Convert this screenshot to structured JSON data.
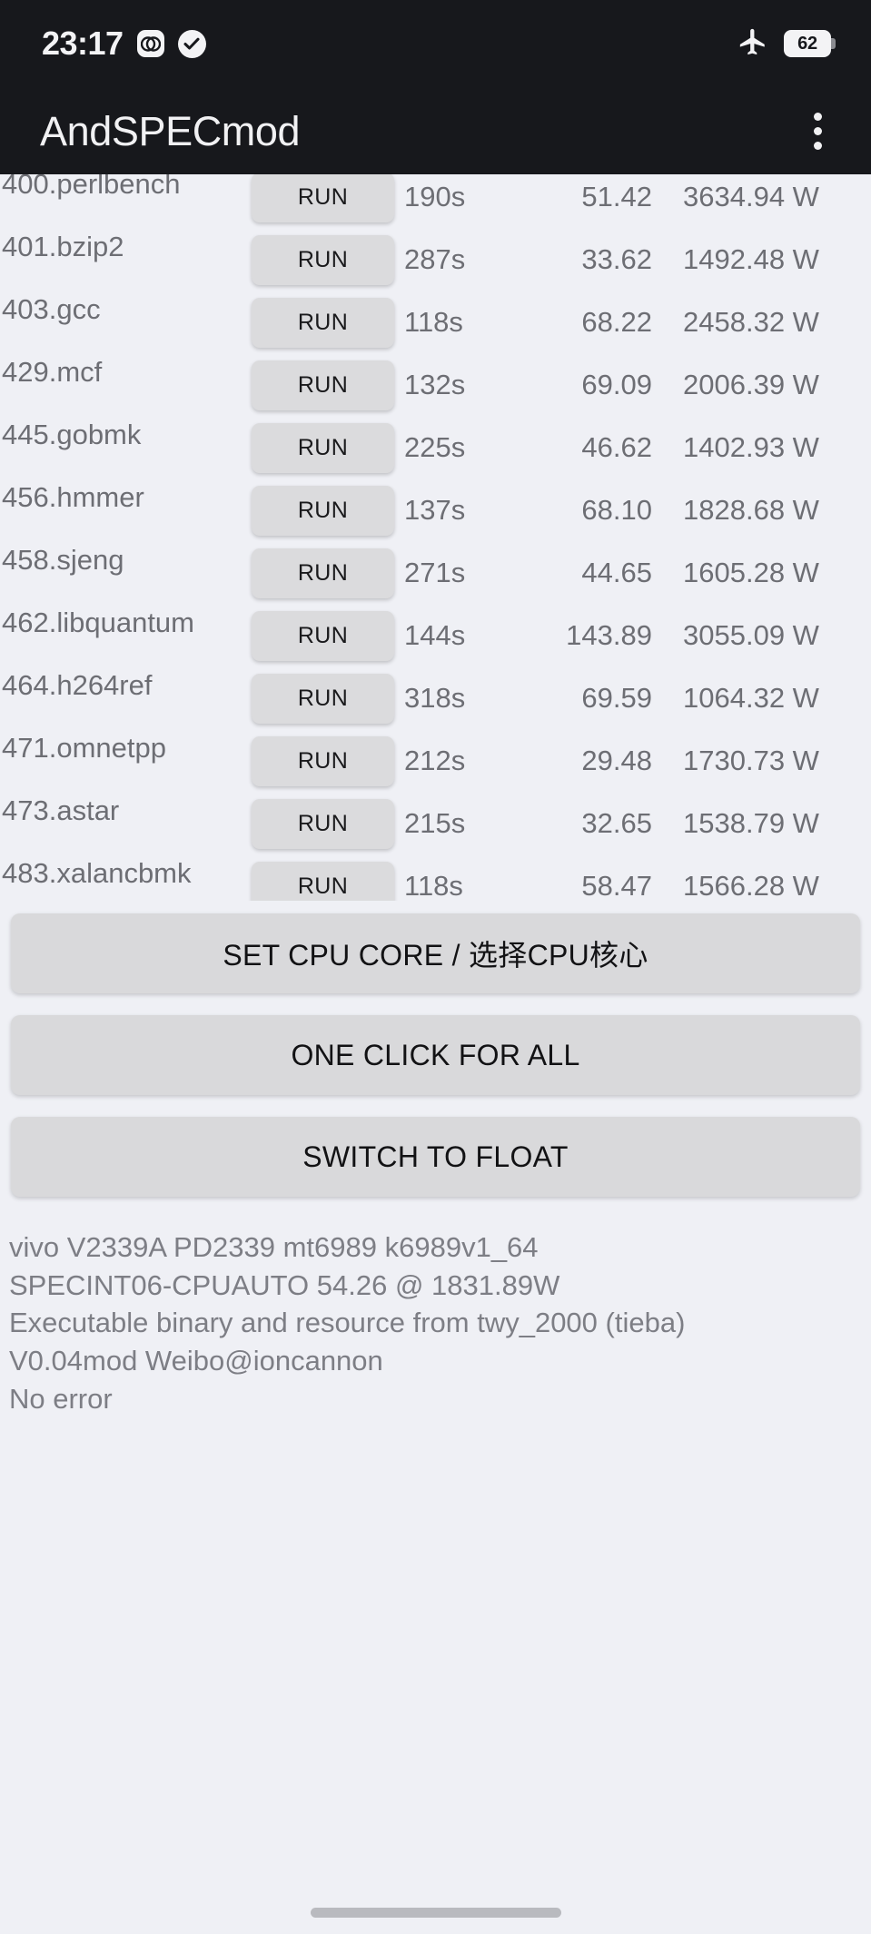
{
  "status_bar": {
    "clock": "23:17",
    "icons": [
      "dual-sim-icon",
      "check-circle-icon"
    ],
    "airplane_icon": "airplane-icon",
    "battery_level": "62"
  },
  "app_bar": {
    "title": "AndSPECmod",
    "overflow_icon": "overflow-menu-icon"
  },
  "table": {
    "run_label": "RUN",
    "rows": [
      {
        "name": "400.perlbench",
        "time": "190s",
        "score": "51.42",
        "power": "3634.94 W"
      },
      {
        "name": "401.bzip2",
        "time": "287s",
        "score": "33.62",
        "power": "1492.48 W"
      },
      {
        "name": "403.gcc",
        "time": "118s",
        "score": "68.22",
        "power": "2458.32 W"
      },
      {
        "name": "429.mcf",
        "time": "132s",
        "score": "69.09",
        "power": "2006.39 W"
      },
      {
        "name": "445.gobmk",
        "time": "225s",
        "score": "46.62",
        "power": "1402.93 W"
      },
      {
        "name": "456.hmmer",
        "time": "137s",
        "score": "68.10",
        "power": "1828.68 W"
      },
      {
        "name": "458.sjeng",
        "time": "271s",
        "score": "44.65",
        "power": "1605.28 W"
      },
      {
        "name": "462.libquantum",
        "time": "144s",
        "score": "143.89",
        "power": "3055.09 W"
      },
      {
        "name": "464.h264ref",
        "time": "318s",
        "score": "69.59",
        "power": "1064.32 W"
      },
      {
        "name": "471.omnetpp",
        "time": "212s",
        "score": "29.48",
        "power": "1730.73 W"
      },
      {
        "name": "473.astar",
        "time": "215s",
        "score": "32.65",
        "power": "1538.79 W"
      },
      {
        "name": "483.xalancbmk",
        "time": "118s",
        "score": "58.47",
        "power": "1566.28 W"
      }
    ]
  },
  "actions": {
    "set_cpu_core": "SET CPU CORE / 选择CPU核心",
    "one_click_for_all": "ONE CLICK FOR ALL",
    "switch_to_float": "SWITCH TO FLOAT"
  },
  "footer": {
    "lines": [
      "vivo V2339A PD2339 mt6989 k6989v1_64",
      "SPECINT06-CPUAUTO  54.26 @ 1831.89W",
      "Executable binary and resource from twy_2000 (tieba)",
      "V0.04mod  Weibo@ioncannon",
      "No error"
    ]
  },
  "colors": {
    "status_bar_bg": "#17181c",
    "page_bg": "#eff0f5",
    "button_bg": "#d9d9db",
    "text_muted": "#6d6e74"
  }
}
